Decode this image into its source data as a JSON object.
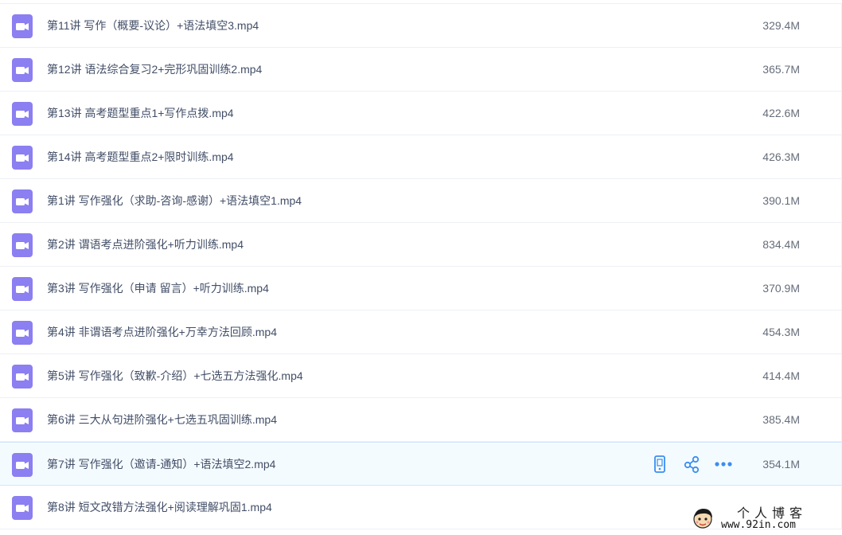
{
  "files": [
    {
      "name": "第11讲 写作（概要-议论）+语法填空3.mp4",
      "size": "329.4M",
      "icon": "video-icon"
    },
    {
      "name": "第12讲 语法综合复习2+完形巩固训练2.mp4",
      "size": "365.7M",
      "icon": "video-icon"
    },
    {
      "name": "第13讲 高考题型重点1+写作点拨.mp4",
      "size": "422.6M",
      "icon": "video-icon"
    },
    {
      "name": "第14讲 高考题型重点2+限时训练.mp4",
      "size": "426.3M",
      "icon": "video-icon"
    },
    {
      "name": "第1讲 写作强化（求助-咨询-感谢）+语法填空1.mp4",
      "size": "390.1M",
      "icon": "video-icon"
    },
    {
      "name": "第2讲 谓语考点进阶强化+听力训练.mp4",
      "size": "834.4M",
      "icon": "video-icon"
    },
    {
      "name": "第3讲 写作强化（申请 留言）+听力训练.mp4",
      "size": "370.9M",
      "icon": "video-icon"
    },
    {
      "name": "第4讲 非谓语考点进阶强化+万幸方法回顾.mp4",
      "size": "454.3M",
      "icon": "video-icon"
    },
    {
      "name": "第5讲 写作强化（致歉-介绍）+七选五方法强化.mp4",
      "size": "414.4M",
      "icon": "video-icon"
    },
    {
      "name": "第6讲 三大从句进阶强化+七选五巩固训练.mp4",
      "size": "385.4M",
      "icon": "video-icon"
    },
    {
      "name": "第7讲 写作强化（邀请-通知）+语法填空2.mp4",
      "size": "354.1M",
      "icon": "video-icon"
    },
    {
      "name": "第8讲 短文改错方法强化+阅读理解巩固1.mp4",
      "size": "",
      "icon": "video-icon"
    }
  ],
  "hover_row_index": 10,
  "row_actions": [
    {
      "name": "phone-icon",
      "label": "send to phone"
    },
    {
      "name": "share-icon",
      "label": "share"
    },
    {
      "name": "more-icon",
      "label": "more"
    }
  ],
  "watermark": {
    "title": "个人博客",
    "site": "www.92in.com"
  },
  "colors": {
    "icon_bg": "#8b7ff1",
    "action_blue": "#3b8ef0",
    "hover_bg": "#f4fbff"
  }
}
